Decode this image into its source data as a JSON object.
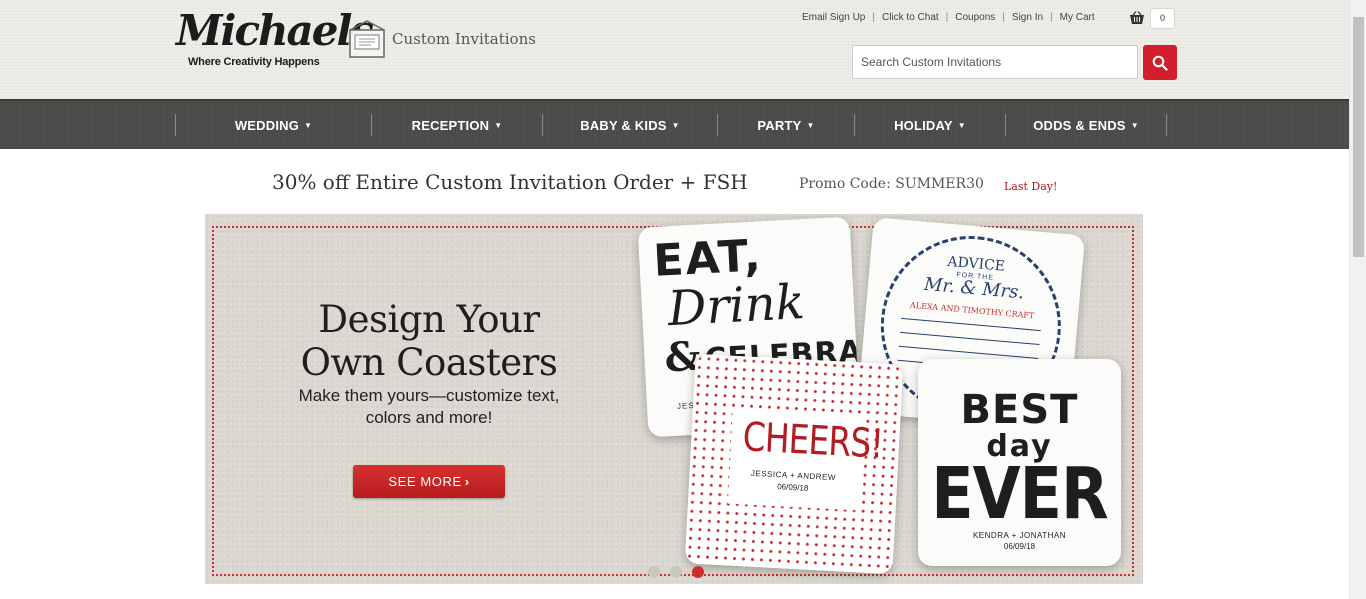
{
  "header": {
    "logo_word": "Michaels",
    "logo_tagline": "Where Creativity Happens",
    "section_label": "Custom Invitations",
    "util_links": [
      "Email Sign Up",
      "Click to Chat",
      "Coupons",
      "Sign In",
      "My Cart"
    ],
    "cart_count": "0",
    "search_placeholder": "Search Custom Invitations",
    "search_value": ""
  },
  "nav": {
    "items": [
      "WEDDING",
      "RECEPTION",
      "BABY & KIDS",
      "PARTY",
      "HOLIDAY",
      "ODDS & ENDS"
    ]
  },
  "promo": {
    "headline": "30% off Entire Custom Invitation Order + FSH",
    "code_text": "Promo Code: SUMMER30",
    "urgency": "Last Day!"
  },
  "hero": {
    "title_line1": "Design Your",
    "title_line2": "Own Coasters",
    "subtitle_line1": "Make them yours—customize text,",
    "subtitle_line2": "colors and more!",
    "cta_label": "SEE MORE",
    "coasters": {
      "eat_big": "EAT,",
      "eat_script": "Drink",
      "eat_amp": "&",
      "eat_celebrate": "CELEBRATE",
      "eat_names": "JESS",
      "advice_title": "ADVICE",
      "advice_small": "FOR THE",
      "advice_mr": "Mr. & Mrs.",
      "advice_names": "ALEXA AND TIMOTHY CRAFT",
      "cheers_word": "CHEERS!",
      "cheers_names": "JESSICA + ANDREW",
      "cheers_date": "06/09/18",
      "best_1": "BEST",
      "best_2": "day",
      "best_3": "EVER",
      "best_names": "KENDRA + JONATHAN",
      "best_date": "06/09/18"
    },
    "slides_total": 3,
    "active_slide": 3
  },
  "colors": {
    "brand_red": "#d11f2e",
    "nav_bg": "#4a4a49",
    "header_bg": "#efede8",
    "promo_accent": "#b11b22"
  }
}
